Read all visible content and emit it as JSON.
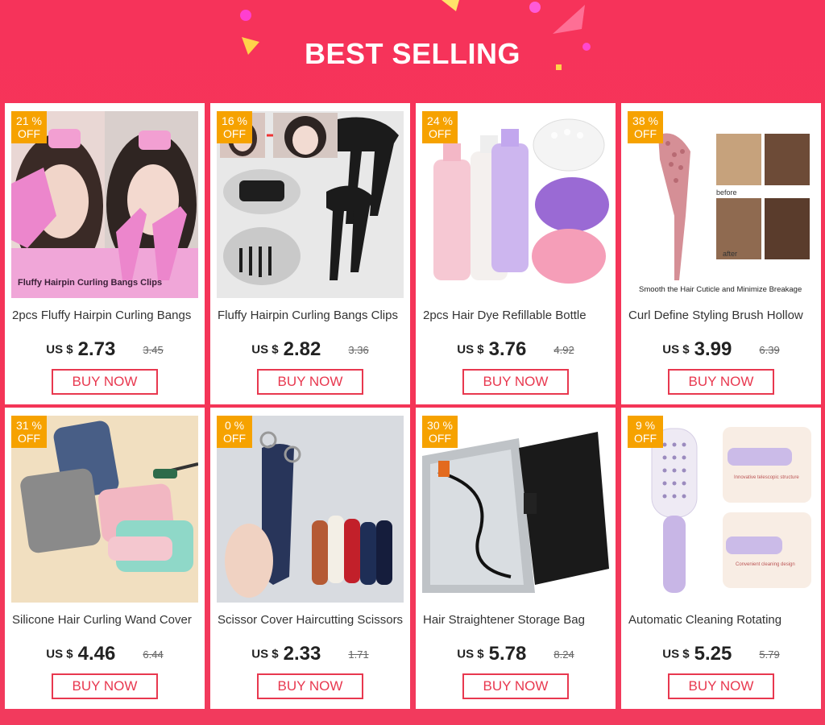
{
  "header": {
    "title": "BEST SELLING"
  },
  "colors": {
    "background": "#f43557",
    "discount_badge": "#f6a200",
    "button": "#e8384f"
  },
  "products": [
    {
      "discount": "21 %",
      "discount_label": "OFF",
      "image_caption": "Fluffy Hairpin Curling Bangs Clips",
      "name": "2pcs Fluffy Hairpin Curling Bangs",
      "currency": "US $",
      "price": "2.73",
      "old_price": "3.45",
      "button": "BUY NOW"
    },
    {
      "discount": "16 %",
      "discount_label": "OFF",
      "image_caption": "",
      "name": "Fluffy Hairpin Curling Bangs Clips",
      "currency": "US $",
      "price": "2.82",
      "old_price": "3.36",
      "button": "BUY NOW"
    },
    {
      "discount": "24 %",
      "discount_label": "OFF",
      "image_caption": "",
      "name": "2pcs Hair Dye Refillable Bottle",
      "currency": "US $",
      "price": "3.76",
      "old_price": "4.92",
      "button": "BUY NOW"
    },
    {
      "discount": "38 %",
      "discount_label": "OFF",
      "image_caption": "Smooth the Hair Cuticle and Minimize Breakage",
      "image_before": "before",
      "image_after": "after",
      "name": "Curl Define Styling Brush Hollow",
      "currency": "US $",
      "price": "3.99",
      "old_price": "6.39",
      "button": "BUY NOW"
    },
    {
      "discount": "31 %",
      "discount_label": "OFF",
      "image_caption": "",
      "name": "Silicone Hair Curling Wand Cover",
      "currency": "US $",
      "price": "4.46",
      "old_price": "6.44",
      "button": "BUY NOW"
    },
    {
      "discount": "0 %",
      "discount_label": "OFF",
      "image_caption": "",
      "name": "Scissor Cover Haircutting Scissors",
      "currency": "US $",
      "price": "2.33",
      "old_price": "1.71",
      "button": "BUY NOW"
    },
    {
      "discount": "30 %",
      "discount_label": "OFF",
      "image_caption": "",
      "name": "Hair Straightener Storage Bag",
      "currency": "US $",
      "price": "5.78",
      "old_price": "8.24",
      "button": "BUY NOW"
    },
    {
      "discount": "9 %",
      "discount_label": "OFF",
      "image_caption": "Innovative telescopic structure",
      "image_caption2": "Convenient cleaning design",
      "name": "Automatic Cleaning Rotating",
      "currency": "US $",
      "price": "5.25",
      "old_price": "5.79",
      "button": "BUY NOW"
    }
  ]
}
